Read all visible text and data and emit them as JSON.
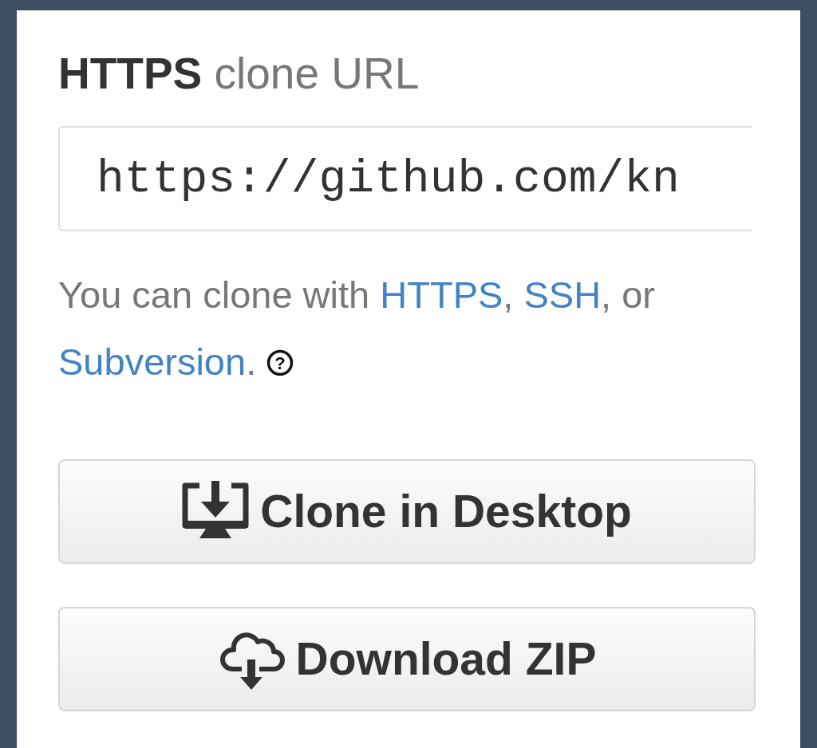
{
  "clone_url": {
    "protocol": "HTTPS",
    "label": "clone URL",
    "value": "https://github.com/kn"
  },
  "help": {
    "parts": [
      {
        "kind": "text",
        "text": "You can clone with "
      },
      {
        "kind": "link",
        "text": "HTTPS"
      },
      {
        "kind": "text",
        "text": ", "
      },
      {
        "kind": "link",
        "text": "SSH"
      },
      {
        "kind": "text",
        "text": ", or "
      },
      {
        "kind": "link",
        "text": "Subversion"
      },
      {
        "kind": "text",
        "text": ". "
      }
    ],
    "help_icon": "?"
  },
  "buttons": [
    {
      "kind": "desktop",
      "label": "Clone in Desktop"
    },
    {
      "kind": "zip",
      "label": "Download ZIP"
    }
  ]
}
